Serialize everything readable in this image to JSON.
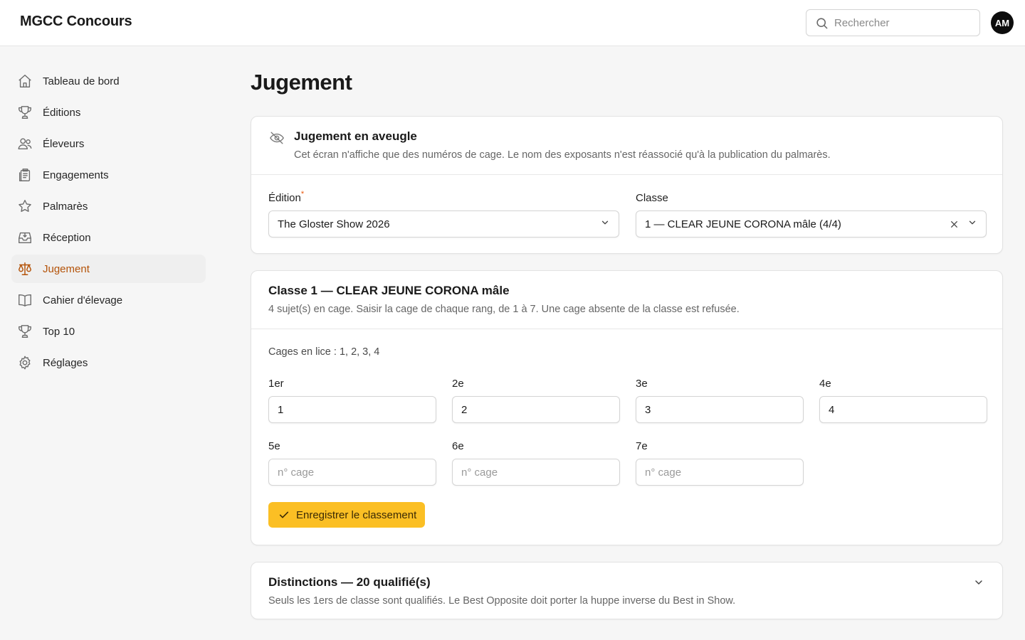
{
  "app": {
    "brand": "MGCC Concours",
    "avatar_initials": "AM"
  },
  "search": {
    "placeholder": "Rechercher"
  },
  "sidebar": {
    "items": [
      {
        "label": "Tableau de bord",
        "icon": "home-icon"
      },
      {
        "label": "Éditions",
        "icon": "trophy-icon"
      },
      {
        "label": "Éleveurs",
        "icon": "users-icon"
      },
      {
        "label": "Engagements",
        "icon": "clipboard-icon"
      },
      {
        "label": "Palmarès",
        "icon": "star-icon"
      },
      {
        "label": "Réception",
        "icon": "inbox-icon"
      },
      {
        "label": "Jugement",
        "icon": "scale-icon",
        "active": true
      },
      {
        "label": "Cahier d'élevage",
        "icon": "book-icon"
      },
      {
        "label": "Top 10",
        "icon": "trophy-icon"
      },
      {
        "label": "Réglages",
        "icon": "gear-icon"
      }
    ]
  },
  "page": {
    "title": "Jugement"
  },
  "blind_card": {
    "title": "Jugement en aveugle",
    "description": "Cet écran n'affiche que des numéros de cage. Le nom des exposants n'est réassocié qu'à la publication du palmarès.",
    "edition_label": "Édition",
    "edition_required_mark": "*",
    "edition_value": "The Gloster Show 2026",
    "classe_label": "Classe",
    "classe_value": "1 — CLEAR JEUNE CORONA mâle (4/4)"
  },
  "class_card": {
    "title": "Classe 1 — CLEAR JEUNE CORONA mâle",
    "description": "4 sujet(s) en cage. Saisir la cage de chaque rang, de 1 à 7. Une cage absente de la classe est refusée.",
    "cages_in_play": "Cages en lice : 1, 2, 3, 4",
    "ranks": [
      {
        "label": "1er",
        "value": "1",
        "placeholder": "n° cage"
      },
      {
        "label": "2e",
        "value": "2",
        "placeholder": "n° cage"
      },
      {
        "label": "3e",
        "value": "3",
        "placeholder": "n° cage"
      },
      {
        "label": "4e",
        "value": "4",
        "placeholder": "n° cage"
      },
      {
        "label": "5e",
        "value": "",
        "placeholder": "n° cage"
      },
      {
        "label": "6e",
        "value": "",
        "placeholder": "n° cage"
      },
      {
        "label": "7e",
        "value": "",
        "placeholder": "n° cage"
      }
    ],
    "save_label": "Enregistrer le classement"
  },
  "distinctions_card": {
    "title": "Distinctions — 20 qualifié(s)",
    "description": "Seuls les 1ers de classe sont qualifiés. Le Best Opposite doit porter la huppe inverse du Best in Show."
  },
  "colors": {
    "accent": "#b45309",
    "primary_button": "#fbbf24",
    "required": "#ea580c"
  }
}
